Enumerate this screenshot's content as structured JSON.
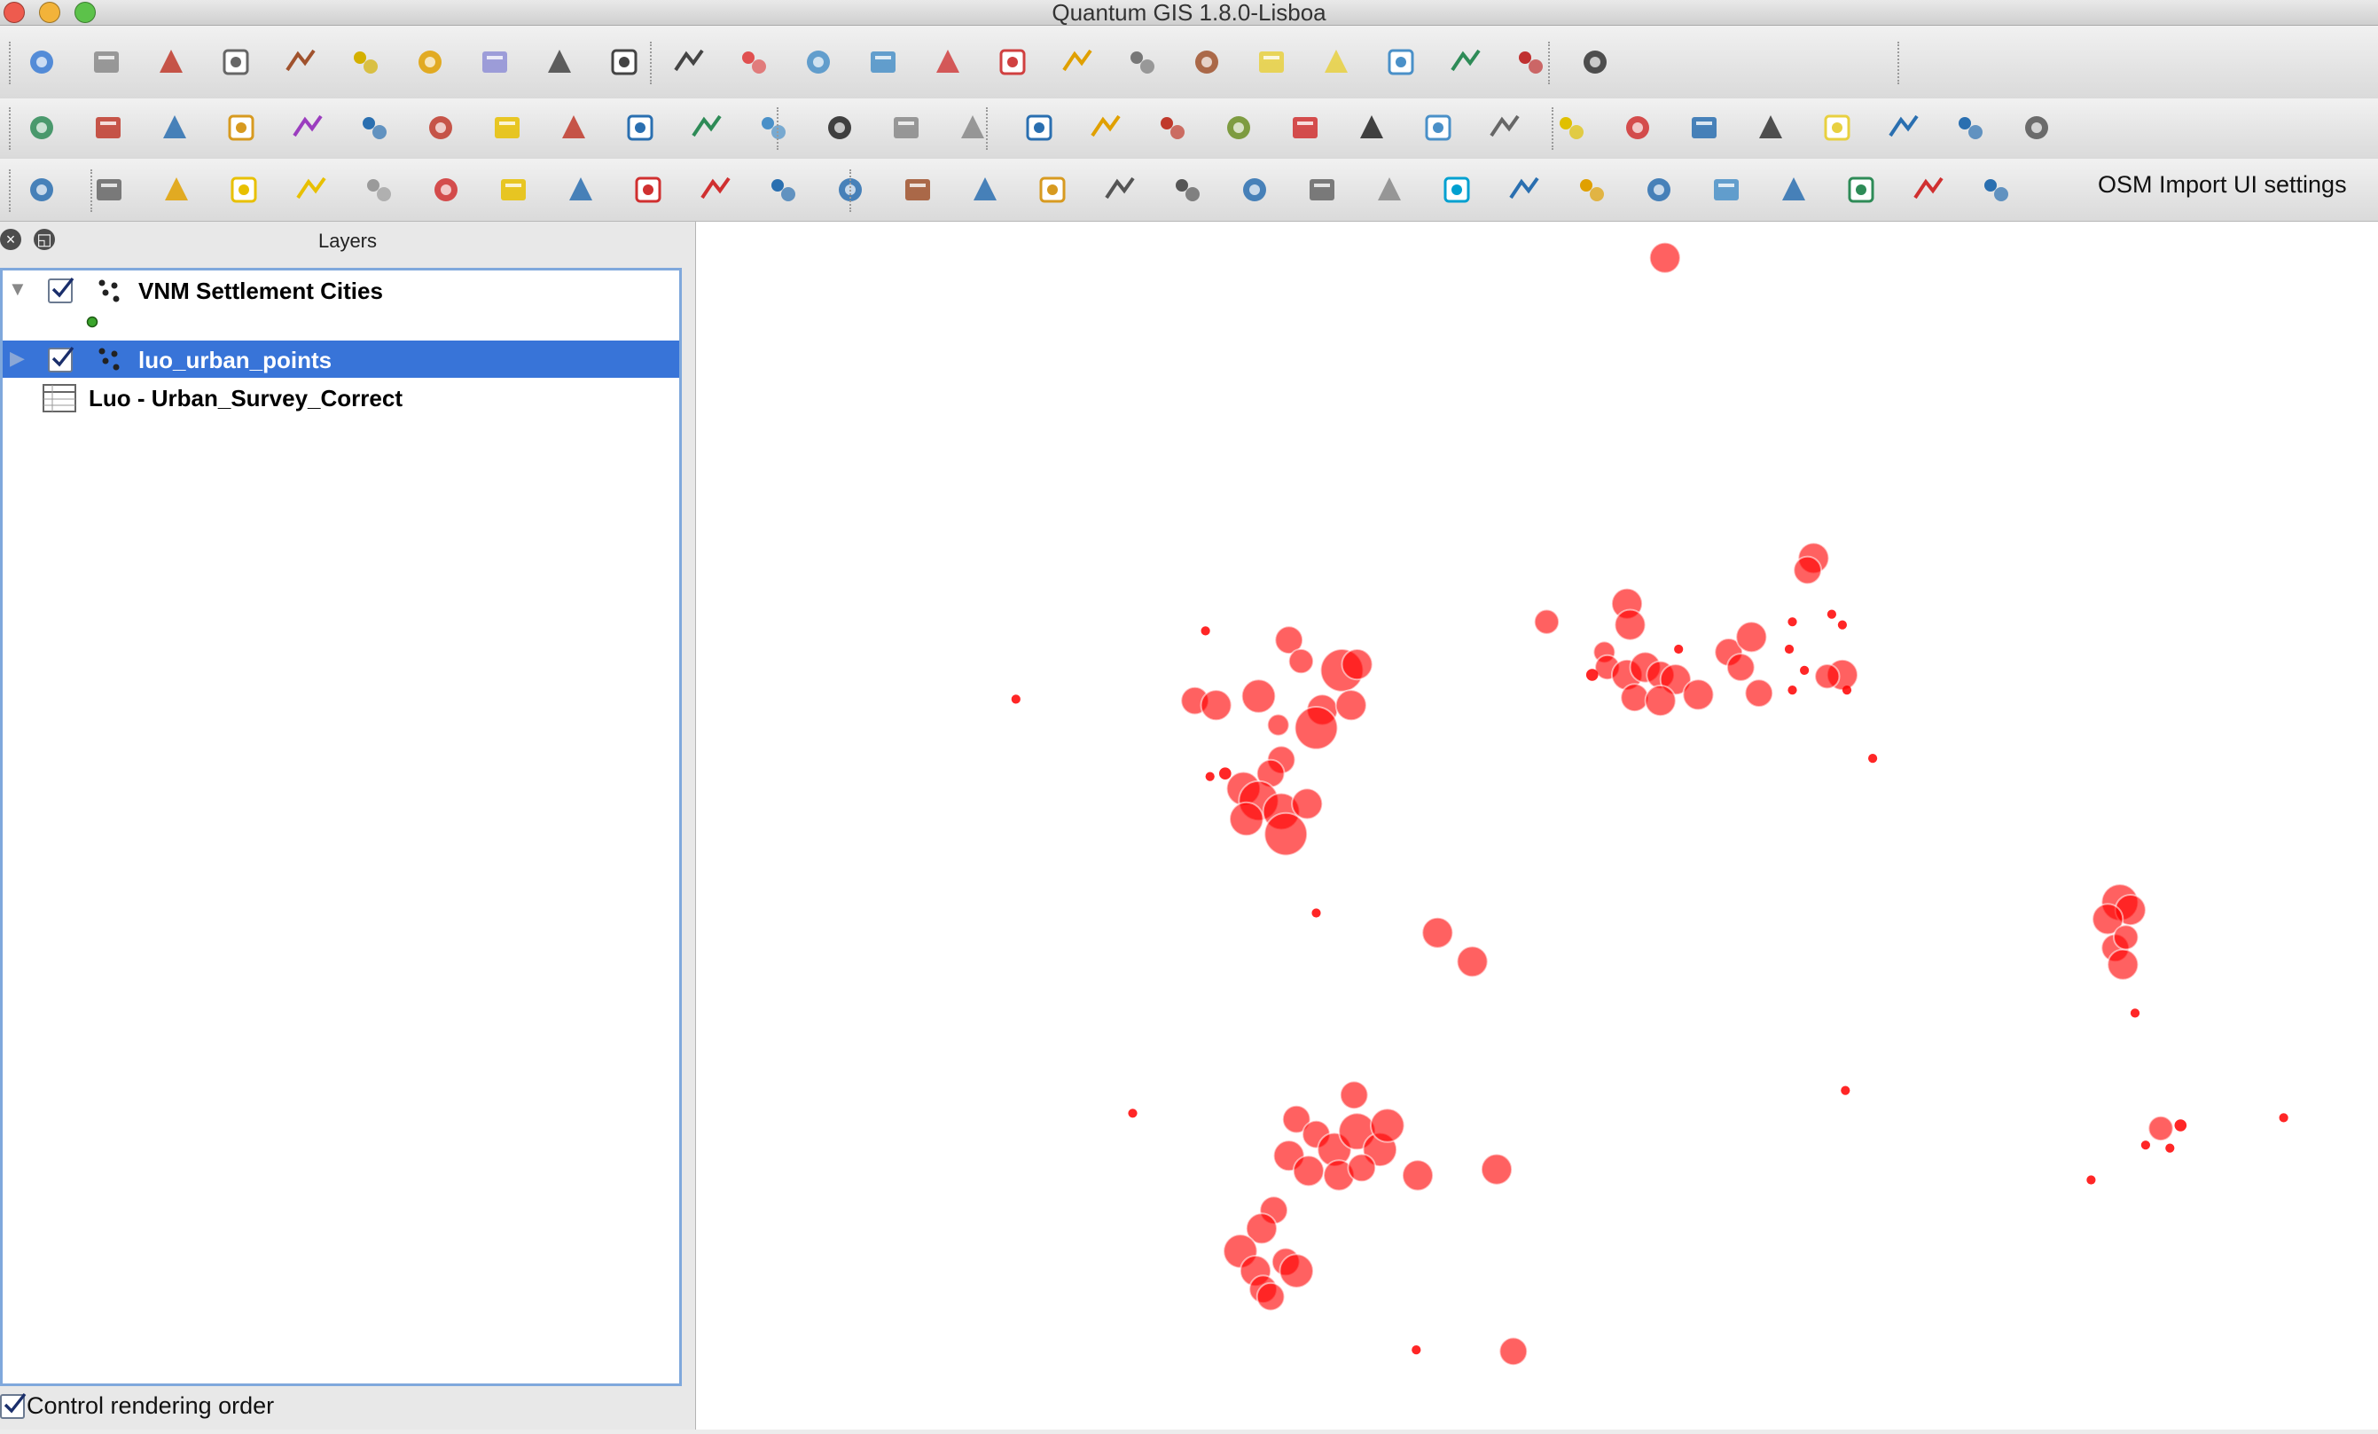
{
  "window": {
    "title": "Quantum GIS 1.8.0-Lisboa"
  },
  "toolbars": {
    "row1": [
      {
        "name": "edit-pencil-icon",
        "c": "#3a7bd5"
      },
      {
        "name": "save-layer-icon",
        "c": "#8a8a8a"
      },
      {
        "name": "add-feature-icon",
        "c": "#c0392b"
      },
      {
        "name": "move-feature-icon",
        "c": "#666"
      },
      {
        "name": "node-tool-icon",
        "c": "#a0522d"
      },
      {
        "name": "delete-selected-icon",
        "c": "#d4b000"
      },
      {
        "name": "cut-features-icon",
        "c": "#e0a000"
      },
      {
        "name": "copy-features-icon",
        "c": "#8f8fd6"
      },
      {
        "name": "more-chevron-icon",
        "c": "#444"
      },
      {
        "name": "undo-icon",
        "c": "#444"
      },
      {
        "name": "redo-icon",
        "c": "#444"
      },
      {
        "name": "simplify-feature-icon",
        "c": "#e05050"
      },
      {
        "name": "add-ring-icon",
        "c": "#4a90c8"
      },
      {
        "name": "add-part-icon",
        "c": "#4a90c8"
      },
      {
        "name": "delete-ring-icon",
        "c": "#d04040"
      },
      {
        "name": "delete-part-icon",
        "c": "#d04040"
      },
      {
        "name": "reshape-icon",
        "c": "#e0a000"
      },
      {
        "name": "offset-curve-icon",
        "c": "#777"
      },
      {
        "name": "split-features-icon",
        "c": "#a0522d"
      },
      {
        "name": "merge-features-icon",
        "c": "#e8d040"
      },
      {
        "name": "merge-attributes-icon",
        "c": "#e8d040"
      },
      {
        "name": "rotate-point-icon",
        "c": "#4a90c8"
      },
      {
        "name": "plugin-icon",
        "c": "#2e8b57"
      },
      {
        "name": "vector-tool-icon",
        "c": "#c03030"
      },
      {
        "name": "sigma-icon",
        "c": "#333"
      }
    ],
    "row2": [
      {
        "name": "add-vector-icon",
        "c": "#2e8b57"
      },
      {
        "name": "add-raster-icon",
        "c": "#c0392b"
      },
      {
        "name": "add-postgis-icon",
        "c": "#2a6fb0"
      },
      {
        "name": "add-spatialite-icon",
        "c": "#d79a20"
      },
      {
        "name": "add-mssql-icon",
        "c": "#9b3dbf"
      },
      {
        "name": "add-wms-icon",
        "c": "#2a6fb0"
      },
      {
        "name": "add-wcs-icon",
        "c": "#c0392b"
      },
      {
        "name": "new-vector-icon",
        "c": "#e8c000"
      },
      {
        "name": "remove-layer-icon",
        "c": "#c0392b"
      },
      {
        "name": "add-csv-icon",
        "c": "#2a6fb0"
      },
      {
        "name": "add-delimited-icon",
        "c": "#2e8b57"
      },
      {
        "name": "help-pointer-icon",
        "c": "#4a90c8"
      },
      {
        "name": "whats-this-icon",
        "c": "#222"
      },
      {
        "name": "georeferencer-icon",
        "c": "#888"
      },
      {
        "name": "histogram-icon",
        "c": "#888"
      },
      {
        "name": "globe-icon",
        "c": "#2a6fb0"
      },
      {
        "name": "heatmap-icon",
        "c": "#e0a000"
      },
      {
        "name": "statistics-icon",
        "c": "#c0392b"
      },
      {
        "name": "terrain-icon",
        "c": "#6b8e23"
      },
      {
        "name": "raster-legend-icon",
        "c": "#d03030"
      },
      {
        "name": "raster-table-icon",
        "c": "#222"
      },
      {
        "name": "identify-icon",
        "c": "#4a90c8"
      },
      {
        "name": "processing-gear-icon",
        "c": "#666"
      },
      {
        "name": "select-features-icon",
        "c": "#e0c000"
      },
      {
        "name": "deselect-icon",
        "c": "#d03030"
      },
      {
        "name": "attribute-table-icon",
        "c": "#2a6fb0"
      },
      {
        "name": "measure-ruler-icon",
        "c": "#333"
      },
      {
        "name": "annotation-icon",
        "c": "#e8d040"
      },
      {
        "name": "map-tips-icon",
        "c": "#2a6fb0"
      },
      {
        "name": "home-icon",
        "c": "#2a6fb0"
      },
      {
        "name": "text-annotation-icon",
        "c": "#555"
      }
    ],
    "row3": [
      {
        "name": "ogr-icon",
        "c": "#2a6fb0"
      },
      {
        "name": "pan-hand-icon",
        "c": "#666"
      },
      {
        "name": "pan-to-selection-icon",
        "c": "#e0a000"
      },
      {
        "name": "zoom-in-icon",
        "c": "#e8c000"
      },
      {
        "name": "zoom-out-icon",
        "c": "#e8c000"
      },
      {
        "name": "zoom-actual-icon",
        "c": "#9a9a9a"
      },
      {
        "name": "zoom-full-icon",
        "c": "#d03030"
      },
      {
        "name": "zoom-layer-icon",
        "c": "#e8c000"
      },
      {
        "name": "zoom-selection-icon",
        "c": "#2a6fb0"
      },
      {
        "name": "zoom-last-icon",
        "c": "#d03030"
      },
      {
        "name": "zoom-next-icon",
        "c": "#d03030"
      },
      {
        "name": "refresh-icon",
        "c": "#2a6fb0"
      },
      {
        "name": "labeling-icon",
        "c": "#2a6fb0"
      },
      {
        "name": "label-pin-icon",
        "c": "#a0522d"
      },
      {
        "name": "label-show-icon",
        "c": "#2a6fb0"
      },
      {
        "name": "label-move-icon",
        "c": "#d79a20"
      },
      {
        "name": "easy-label-icon",
        "c": "#555"
      },
      {
        "name": "label-change-icon",
        "c": "#555"
      },
      {
        "name": "grid-maker-icon",
        "c": "#2a6fb0"
      },
      {
        "name": "print-composer-icon",
        "c": "#666"
      },
      {
        "name": "new-bookmark-icon",
        "c": "#888"
      },
      {
        "name": "raster-calc-icon",
        "c": "#00a0d0"
      },
      {
        "name": "3d-box-icon",
        "c": "#2a6fb0"
      },
      {
        "name": "pencil-edit-icon",
        "c": "#e0a000"
      },
      {
        "name": "raster-reproject-icon",
        "c": "#2a6fb0"
      },
      {
        "name": "raster-clip-icon",
        "c": "#4a90c8"
      },
      {
        "name": "raster-info-icon",
        "c": "#2a6fb0"
      },
      {
        "name": "color-relief-icon",
        "c": "#2e8b57"
      },
      {
        "name": "random-points-icon",
        "c": "#d03030"
      },
      {
        "name": "postgis-elephant-icon",
        "c": "#2a6fb0"
      }
    ],
    "osm_label": "OSM Import UI settings"
  },
  "layers_panel": {
    "title": "Layers",
    "layers": [
      {
        "name": "VNM Settlement Cities"
      },
      {
        "name": "luo_urban_points"
      },
      {
        "name": "Luo - Urban_Survey_Correct"
      }
    ],
    "control_rendering_order": "Control rendering order"
  },
  "map": {
    "symbol_color": "#ff0000"
  }
}
